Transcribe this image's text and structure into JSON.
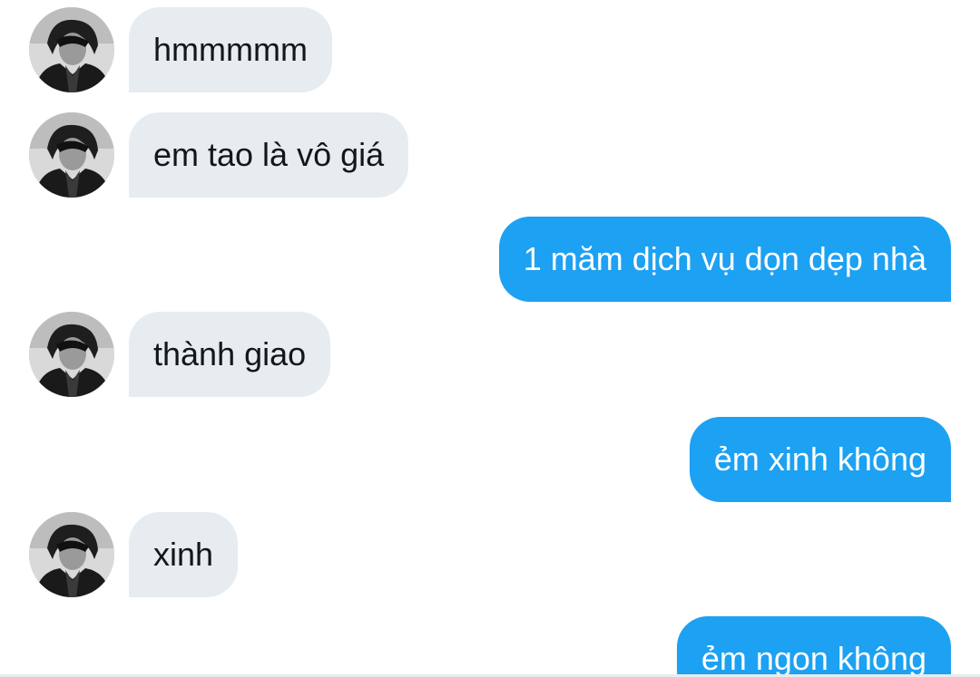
{
  "conversation": {
    "messages": [
      {
        "sender": "contact",
        "text": "hmmmmm"
      },
      {
        "sender": "contact",
        "text": "em tao là vô giá"
      },
      {
        "sender": "me",
        "text": "1 măm dịch vụ dọn dẹp nhà"
      },
      {
        "sender": "contact",
        "text": "thành giao"
      },
      {
        "sender": "me",
        "text": "ẻm xinh không"
      },
      {
        "sender": "contact",
        "text": "xinh"
      },
      {
        "sender": "me",
        "text": "ẻm ngon không"
      }
    ]
  },
  "theme": {
    "incoming_bubble": "#e6ecf0",
    "outgoing_bubble": "#1da1f2",
    "incoming_text": "#14171a",
    "outgoing_text": "#ffffff"
  },
  "icons": {
    "avatar": "contact-avatar-photo"
  }
}
